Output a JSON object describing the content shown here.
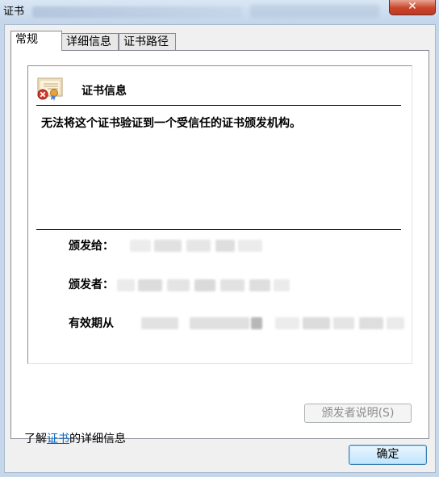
{
  "window": {
    "title": "证书",
    "close_label": "✕"
  },
  "tabs": [
    {
      "label": "常规",
      "active": true
    },
    {
      "label": "详细信息",
      "active": false
    },
    {
      "label": "证书路径",
      "active": false
    }
  ],
  "general": {
    "section_title": "证书信息",
    "message": "无法将这个证书验证到一个受信任的证书颁发机构。",
    "fields": {
      "issued_to_label": "颁发给：",
      "issued_by_label": "颁发者：",
      "valid_from_label": "有效期从"
    },
    "issuer_statement_button": "颁发者说明(S)"
  },
  "footer": {
    "learn_prefix": "了解",
    "learn_link": "证书",
    "learn_suffix": "的详细信息"
  },
  "buttons": {
    "ok": "确定"
  },
  "icons": {
    "certificate": "certificate-error-icon",
    "close": "close-icon"
  },
  "colors": {
    "link": "#0066cc",
    "close_button": "#c9452b",
    "ok_button_border": "#3c7fb1"
  }
}
